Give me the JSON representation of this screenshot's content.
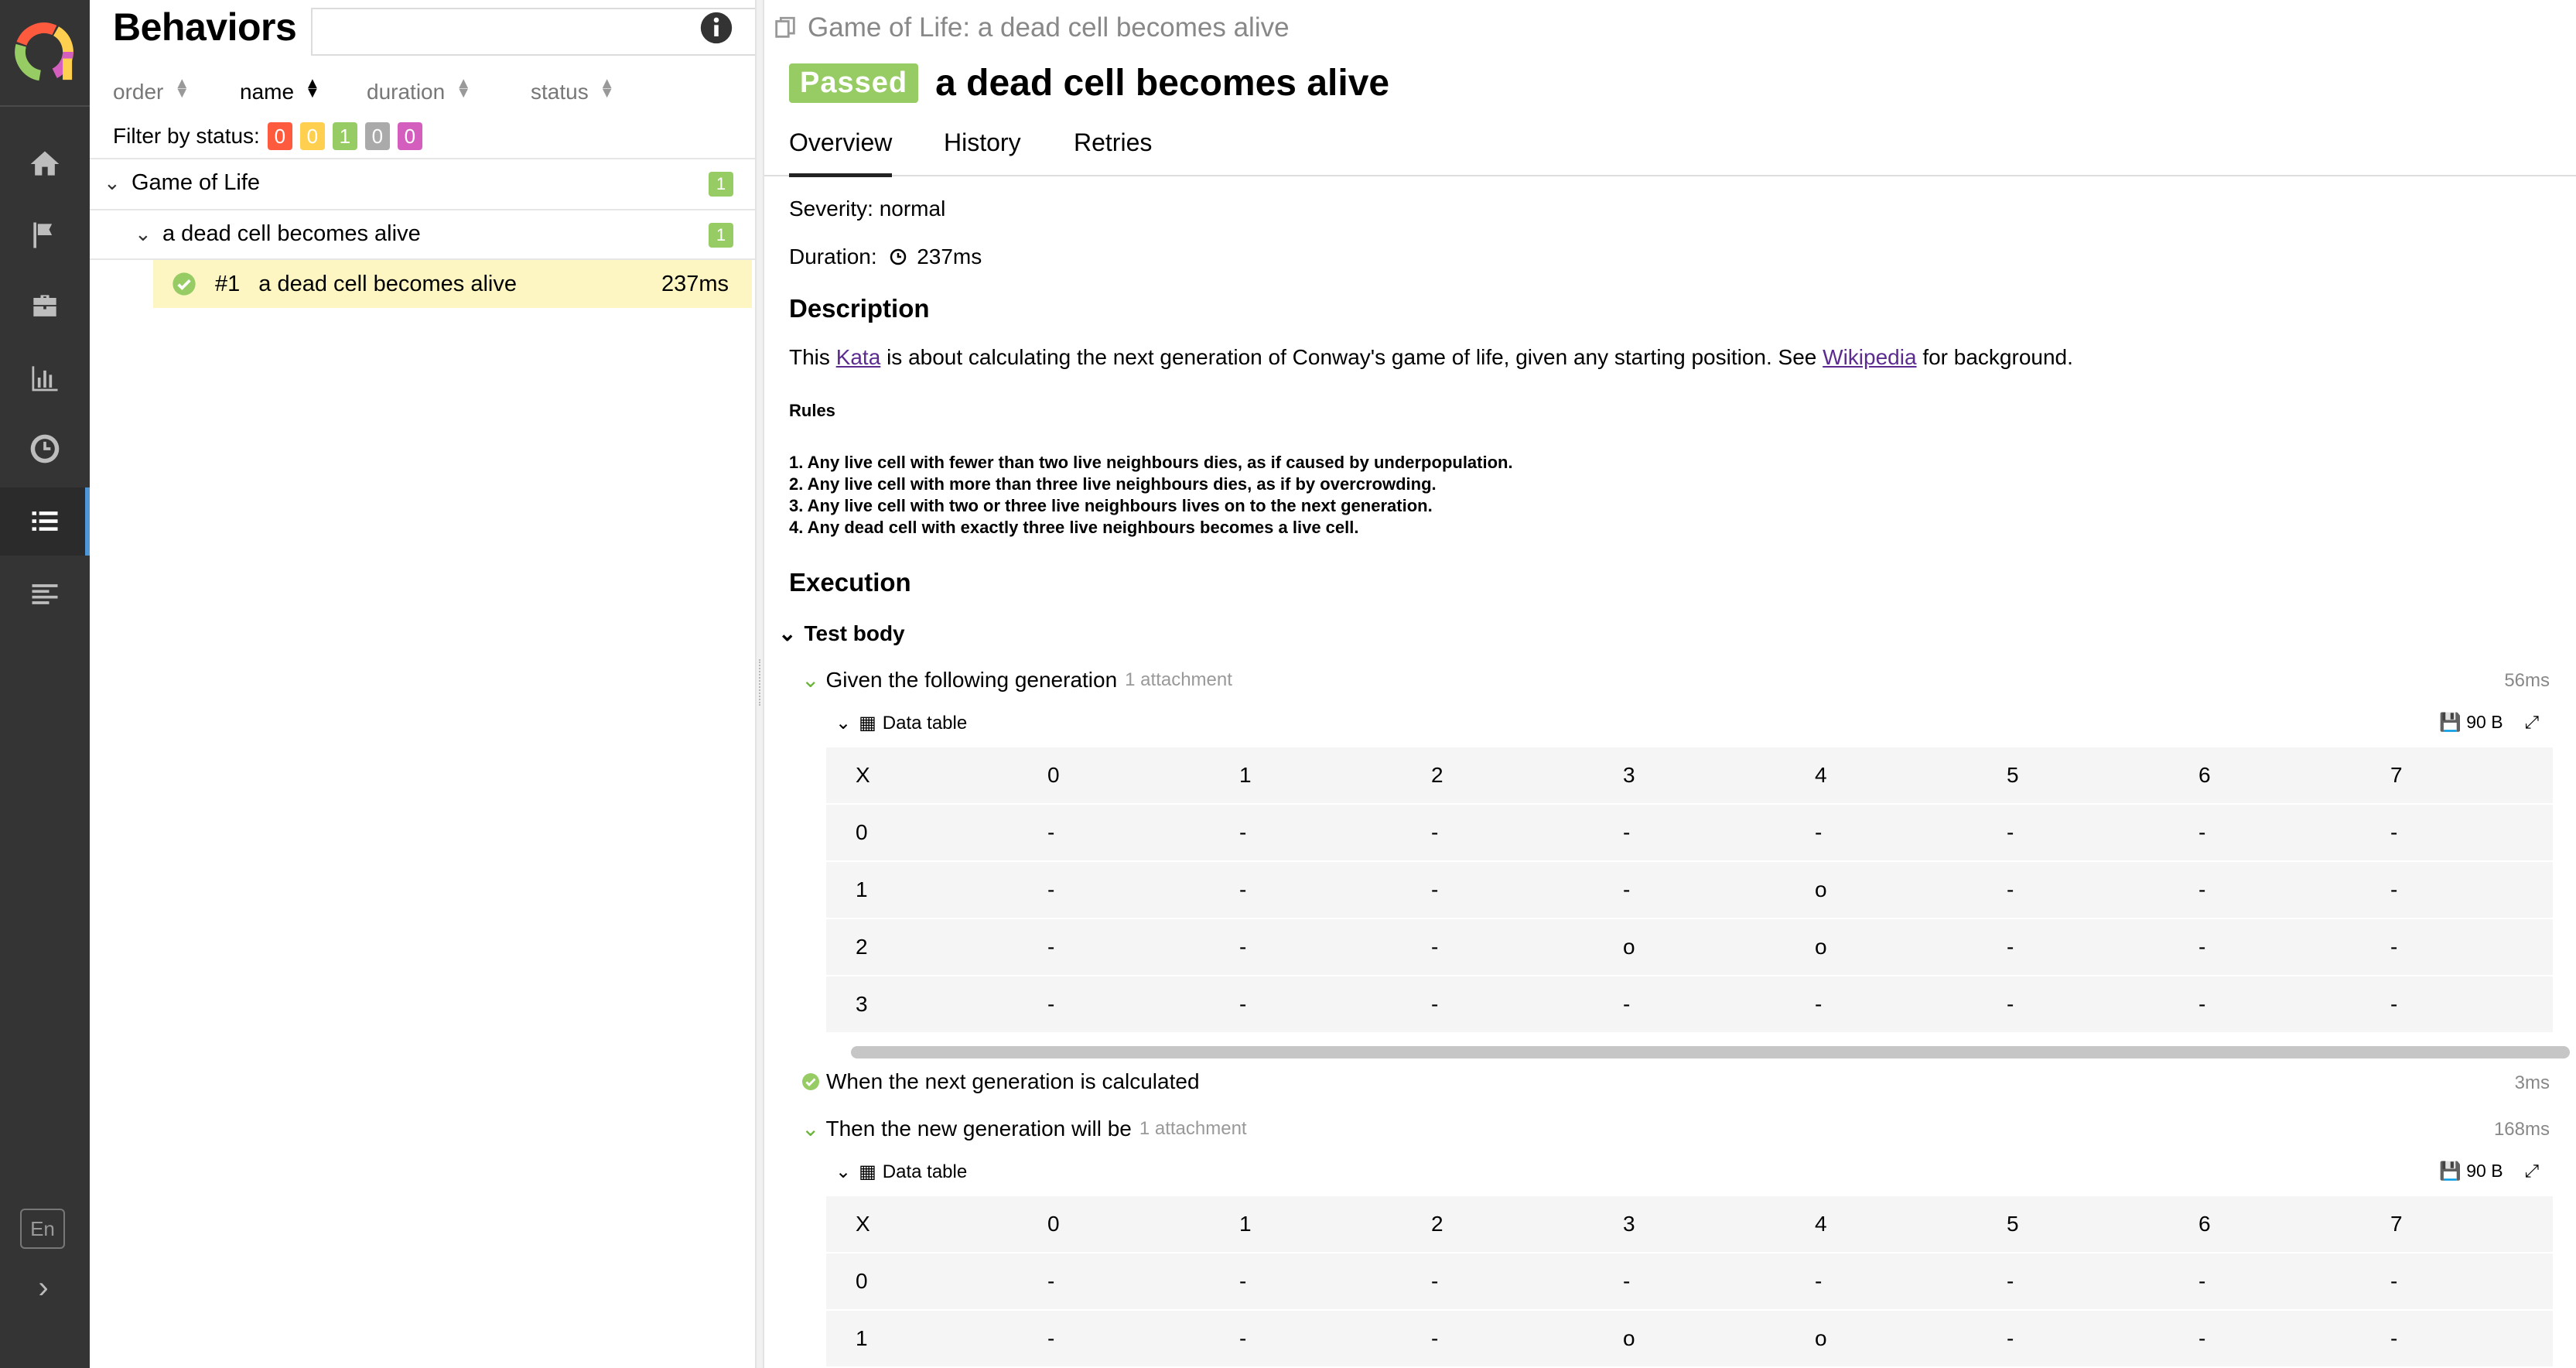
{
  "sidebar": {
    "nav": [
      "overview",
      "categories",
      "suites",
      "graphs",
      "timeline",
      "behaviors",
      "packages"
    ],
    "active": "behaviors",
    "lang": "En"
  },
  "behaviors": {
    "title": "Behaviors",
    "search_placeholder": "",
    "sort": [
      {
        "label": "order",
        "current": false
      },
      {
        "label": "name",
        "current": true
      },
      {
        "label": "duration",
        "current": false
      },
      {
        "label": "status",
        "current": false
      }
    ],
    "filter_label": "Filter by status:",
    "filter_counts": [
      {
        "value": "0",
        "color": "#fd5a3e"
      },
      {
        "value": "0",
        "color": "#ffd050"
      },
      {
        "value": "1",
        "color": "#97cc64"
      },
      {
        "value": "0",
        "color": "#aaaaaa"
      },
      {
        "value": "0",
        "color": "#d35ebe"
      }
    ],
    "tree": [
      {
        "label": "Game of Life",
        "count": "1"
      },
      {
        "label": "a dead cell becomes alive",
        "count": "1"
      }
    ],
    "case": {
      "num": "#1",
      "name": "a dead cell becomes alive",
      "duration": "237ms"
    }
  },
  "detail": {
    "breadcrumb": "Game of Life: a dead cell becomes alive",
    "status": "Passed",
    "title": "a dead cell becomes alive",
    "tabs": [
      "Overview",
      "History",
      "Retries"
    ],
    "severity": "Severity: normal",
    "duration_label": "Duration:",
    "duration": "237ms",
    "description_heading": "Description",
    "description": {
      "pre": "This ",
      "link1": "Kata",
      "mid": " is about calculating the next generation of Conway's game of life, given any starting position. See ",
      "link2": "Wikipedia",
      "post": " for background."
    },
    "rules_heading": "Rules",
    "rules": [
      "1. Any live cell with fewer than two live neighbours dies, as if caused by underpopulation.",
      "2. Any live cell with more than three live neighbours dies, as if by overcrowding.",
      "3. Any live cell with two or three live neighbours lives on to the next generation.",
      "4. Any dead cell with exactly three live neighbours becomes a live cell."
    ],
    "execution_heading": "Execution",
    "test_body": "Test body",
    "steps": [
      {
        "name": "Given the following generation",
        "attachment": "1 attachment",
        "duration": "56ms"
      },
      {
        "name": "When the next generation is calculated",
        "attachment": "",
        "duration": "3ms"
      },
      {
        "name": "Then the new generation will be",
        "attachment": "1 attachment",
        "duration": "168ms"
      }
    ],
    "data_table": {
      "label": "Data table",
      "size": "90 B"
    },
    "table1": [
      [
        "X",
        "0",
        "1",
        "2",
        "3",
        "4",
        "5",
        "6",
        "7"
      ],
      [
        "0",
        "-",
        "-",
        "-",
        "-",
        "-",
        "-",
        "-",
        "-"
      ],
      [
        "1",
        "-",
        "-",
        "-",
        "-",
        "o",
        "-",
        "-",
        "-"
      ],
      [
        "2",
        "-",
        "-",
        "-",
        "o",
        "o",
        "-",
        "-",
        "-"
      ],
      [
        "3",
        "-",
        "-",
        "-",
        "-",
        "-",
        "-",
        "-",
        "-"
      ]
    ],
    "table2": [
      [
        "X",
        "0",
        "1",
        "2",
        "3",
        "4",
        "5",
        "6",
        "7"
      ],
      [
        "0",
        "-",
        "-",
        "-",
        "-",
        "-",
        "-",
        "-",
        "-"
      ],
      [
        "1",
        "-",
        "-",
        "-",
        "o",
        "o",
        "-",
        "-",
        "-"
      ]
    ]
  }
}
